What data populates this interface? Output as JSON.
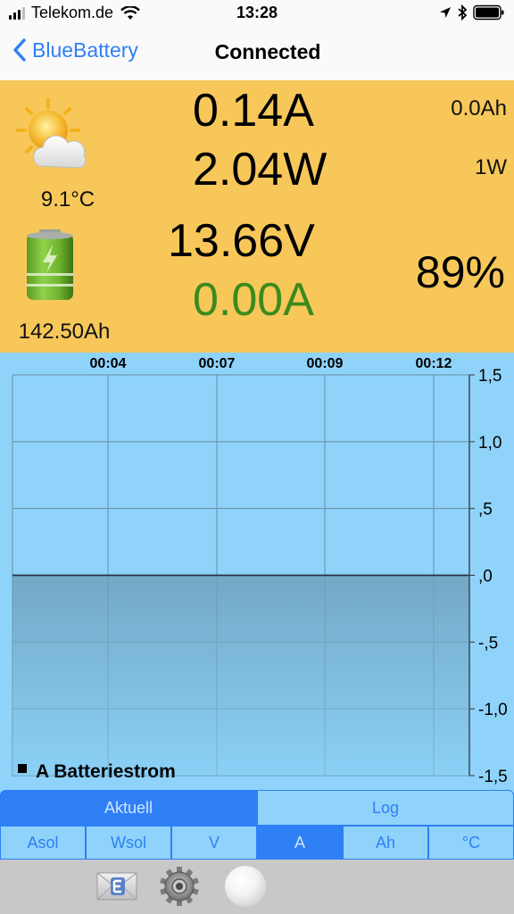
{
  "status_bar": {
    "carrier": "Telekom.de",
    "time": "13:28"
  },
  "nav": {
    "back_label": "BlueBattery",
    "title": "Connected"
  },
  "panel": {
    "temperature": "9.1°C",
    "capacity": "142.50Ah",
    "current": "0.14A",
    "power": "2.04W",
    "voltage": "13.66V",
    "battery_current": "0.00A",
    "ah": "0.0Ah",
    "watts": "1W",
    "soc": "89%",
    "battery_current_color": "#3c8a1c"
  },
  "chart_data": {
    "type": "area",
    "x_tick_labels": [
      "00:04",
      "00:07",
      "00:09",
      "00:12"
    ],
    "y_tick_labels": [
      "1,5",
      "1,0",
      ",5",
      ",0",
      "-,5",
      "-1,0",
      "-1,5"
    ],
    "ylim": [
      -1.5,
      1.5
    ],
    "grid": true,
    "legend": "bottom-left",
    "series": [
      {
        "name": "A Batteriestrom",
        "values": [
          0,
          0,
          0,
          0,
          0
        ],
        "color": "#000000"
      }
    ]
  },
  "tabs_top": [
    {
      "label": "Aktuell",
      "active": true
    },
    {
      "label": "Log",
      "active": false
    }
  ],
  "tabs_bottom": [
    {
      "label": "Asol",
      "active": false
    },
    {
      "label": "Wsol",
      "active": false
    },
    {
      "label": "V",
      "active": false
    },
    {
      "label": "A",
      "active": true
    },
    {
      "label": "Ah",
      "active": false
    },
    {
      "label": "°C",
      "active": false
    }
  ],
  "toolbar": {
    "icons": [
      "mail-icon",
      "gear-icon",
      "ball-icon"
    ]
  },
  "colors": {
    "panel_bg": "#f7c75a",
    "chart_bg": "#8fd3fb",
    "accent": "#2f7ff5"
  }
}
